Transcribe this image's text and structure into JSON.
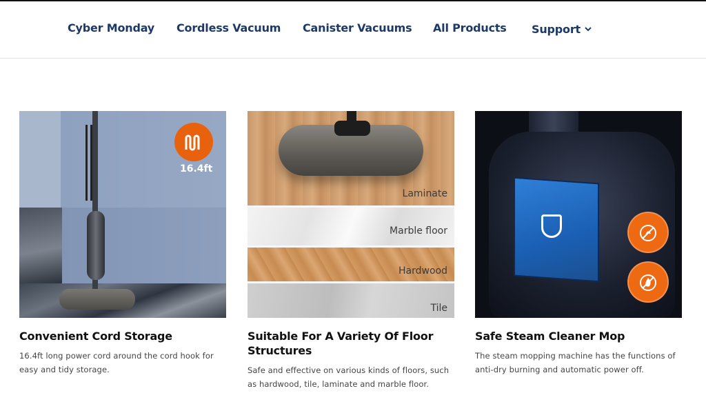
{
  "nav": {
    "items": [
      "Cyber Monday",
      "Cordless Vacuum",
      "Canister Vacuums",
      "All Products",
      "Support"
    ]
  },
  "cards": [
    {
      "title": "Convenient Cord Storage",
      "desc": "16.4ft long power cord around the cord hook for easy and tidy storage.",
      "image_badge": "16.4ft"
    },
    {
      "title": "Suitable For A Variety Of Floor Structures",
      "desc": "Safe and effective on various kinds of floors, such as hardwood, tile, laminate and marble floor.",
      "floor_labels": [
        "Laminate",
        "Marble floor",
        "Hardwood",
        "Tile"
      ]
    },
    {
      "title": "Safe Steam Cleaner Mop",
      "desc": "The steam mopping machine has the functions of anti-dry burning and automatic power off."
    }
  ],
  "colors": {
    "nav_text": "#1d3a66",
    "accent": "#e8620d",
    "title_text": "#111111",
    "desc_text": "#444444"
  },
  "icons": [
    "chevron-down-icon",
    "cord-wave-icon",
    "shield-check-icon",
    "no-burn-icon",
    "flame-icon"
  ]
}
